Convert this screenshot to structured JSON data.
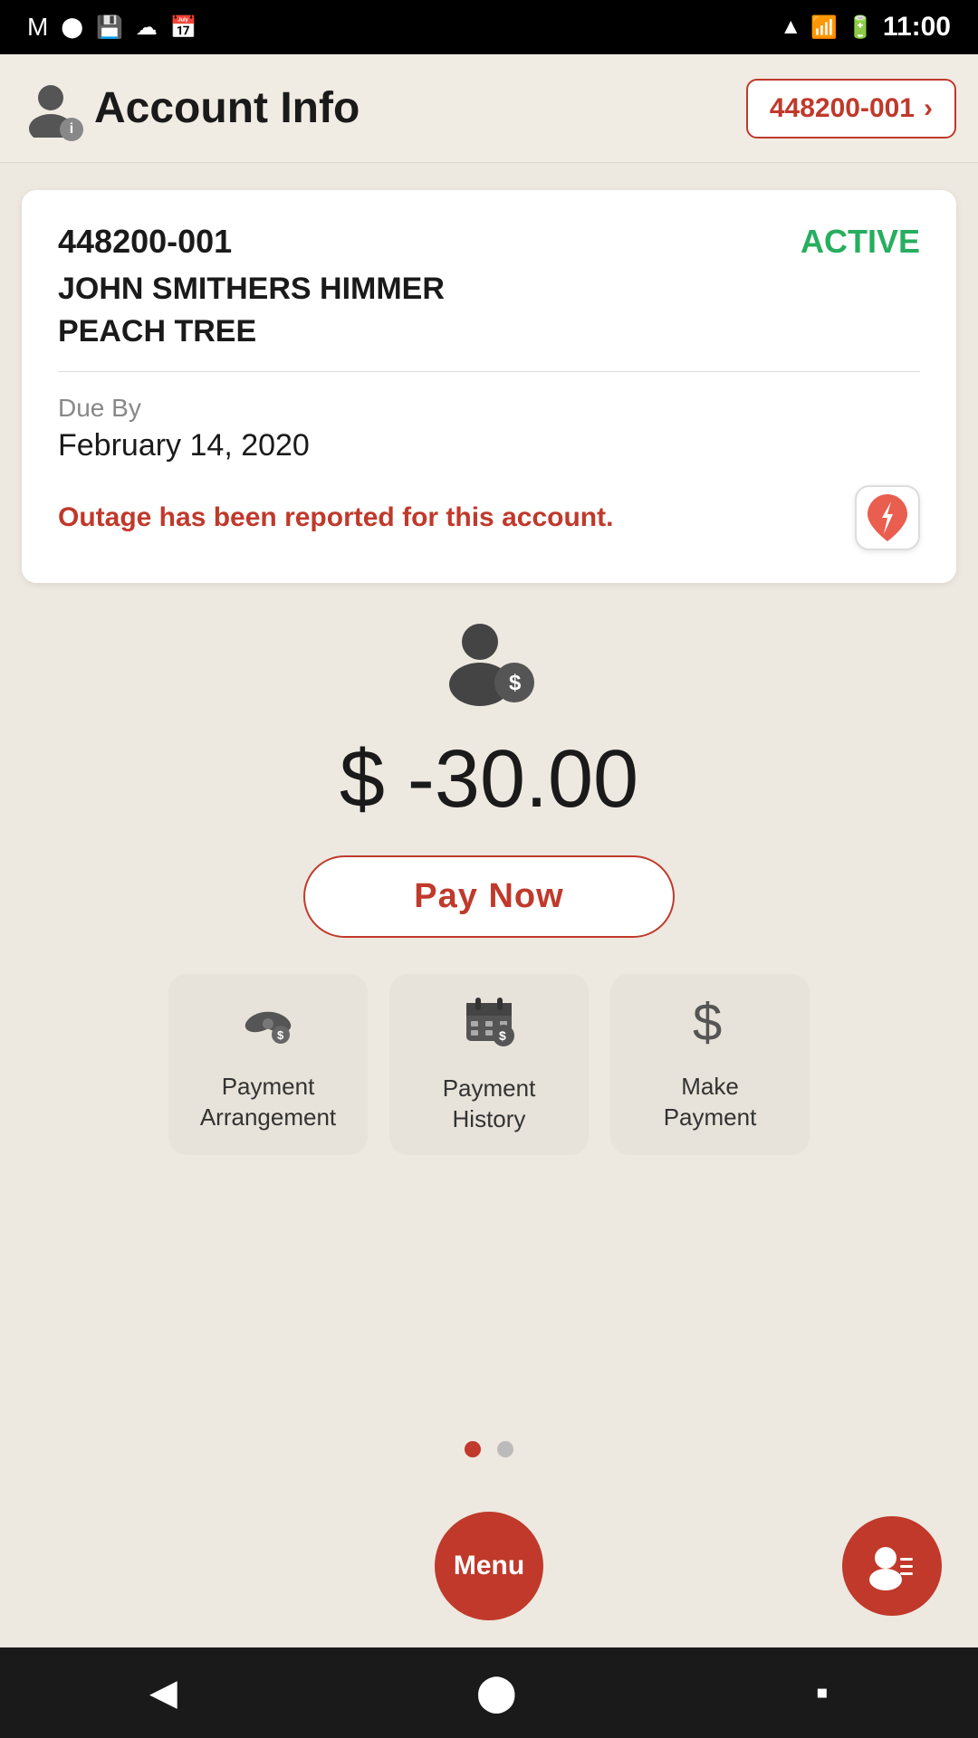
{
  "statusBar": {
    "time": "11:00",
    "icons": [
      "gmail",
      "record",
      "save",
      "cloud",
      "calendar"
    ]
  },
  "header": {
    "title": "Account Info",
    "accountNumber": "448200-001",
    "accountNumberLabel": "448200-001 ›"
  },
  "accountCard": {
    "accountNumber": "448200-001",
    "status": "ACTIVE",
    "customerName": "JOHN SMITHERS HIMMER",
    "location": "PEACH TREE",
    "dueByLabel": "Due By",
    "dueByDate": "February 14, 2020",
    "outageMessage": "Outage has been reported for this account."
  },
  "balance": {
    "amount": "$ -30.00",
    "payNowLabel": "Pay Now"
  },
  "actionButtons": [
    {
      "id": "payment-arrangement",
      "label": "Payment\nArrangement",
      "icon": "handshake"
    },
    {
      "id": "payment-history",
      "label": "Payment\nHistory",
      "icon": "calendar-dollar"
    },
    {
      "id": "make-payment",
      "label": "Make\nPayment",
      "icon": "dollar"
    }
  ],
  "pageDots": {
    "active": 0,
    "total": 2
  },
  "bottomBar": {
    "menuLabel": "Menu"
  }
}
